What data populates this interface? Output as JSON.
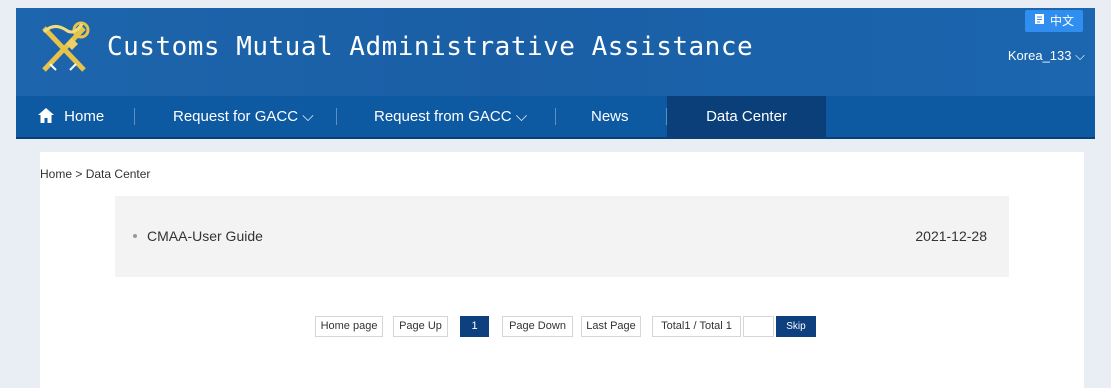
{
  "header": {
    "title": "Customs Mutual Administrative Assistance",
    "logo_icon": "customs-emblem-icon",
    "lang_label": "中文",
    "user": "Korea_133",
    "bg_color": "#1b63aa"
  },
  "nav": {
    "items": [
      {
        "label": "Home",
        "icon": "home-icon"
      },
      {
        "label": "Request for GACC",
        "dropdown": true
      },
      {
        "label": "Request from GACC",
        "dropdown": true
      },
      {
        "label": "News"
      },
      {
        "label": "Data Center",
        "active": true
      }
    ],
    "bg_color": "#0d5aa3",
    "active_color": "#0a3f7a"
  },
  "breadcrumb": {
    "home": "Home",
    "separator": ">",
    "current": "Data Center"
  },
  "list": [
    {
      "title": "CMAA-User Guide",
      "date": "2021-12-28"
    }
  ],
  "pagination": {
    "home": "Home page",
    "prev": "Page Up",
    "current": "1",
    "next": "Page Down",
    "last": "Last Page",
    "total": "Total1 / Total 1",
    "jump_value": "",
    "skip": "Skip",
    "accent": "#0e3f7e"
  }
}
